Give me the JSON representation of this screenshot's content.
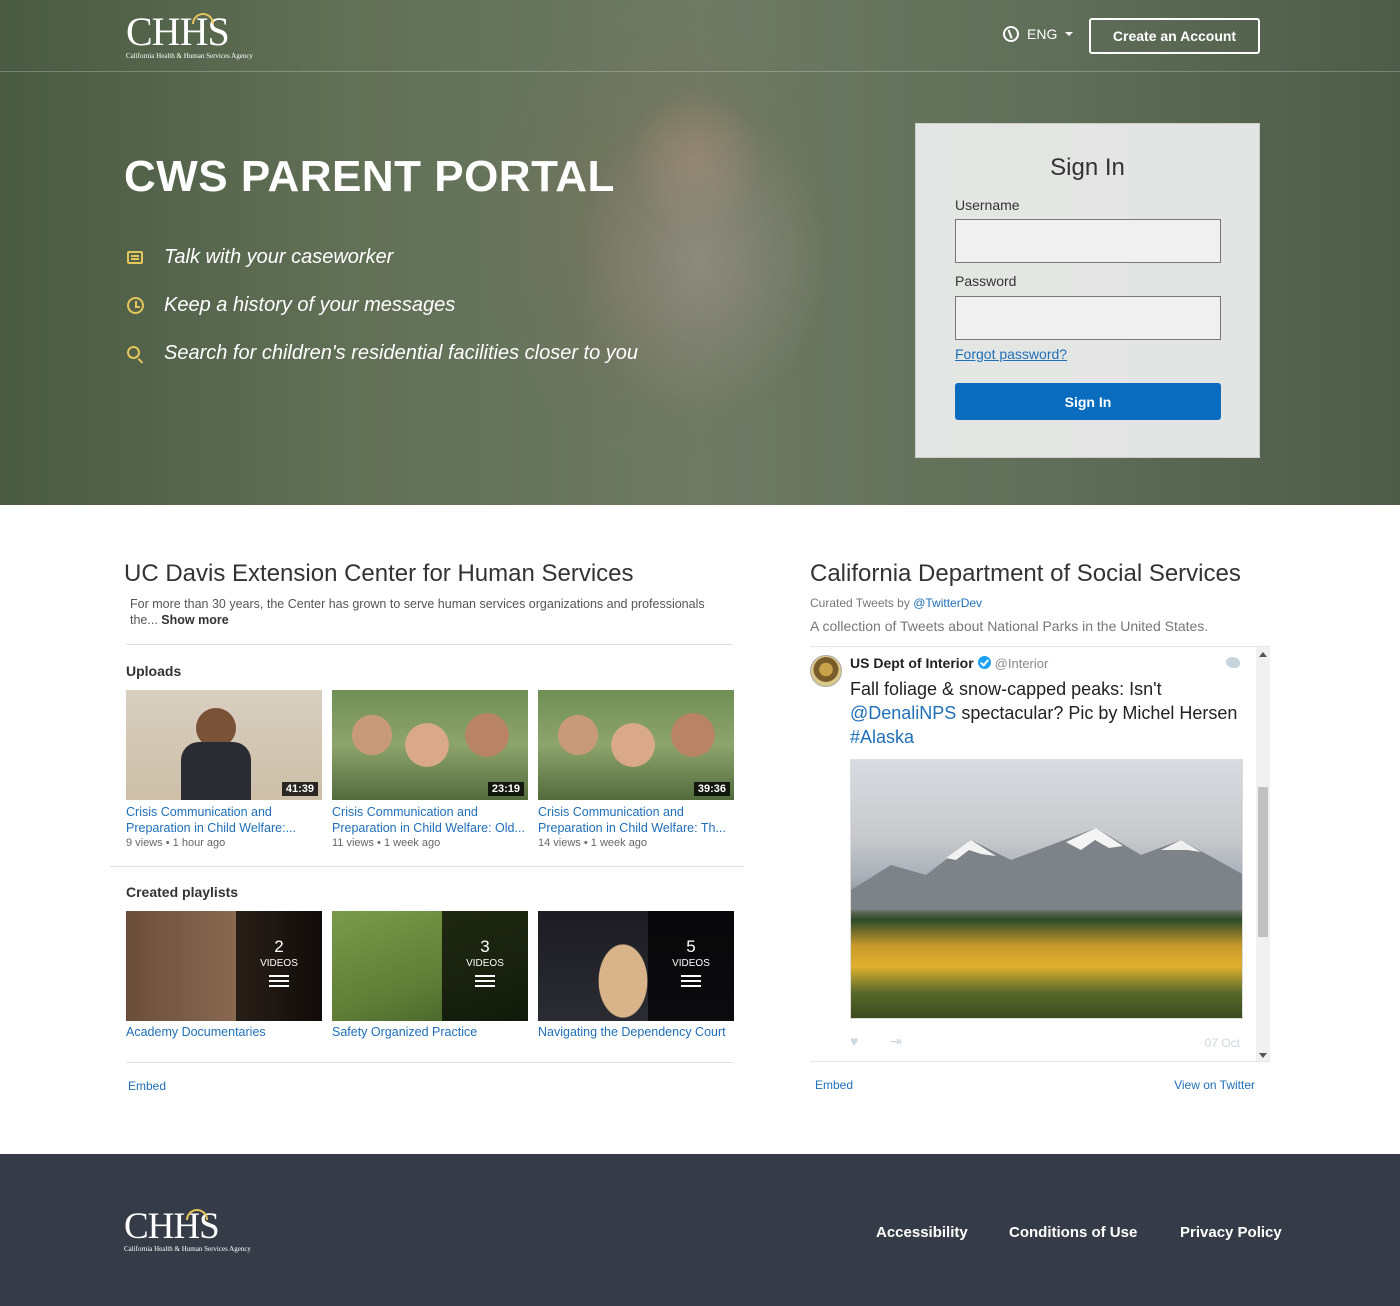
{
  "header": {
    "logo_mark": "CHHS",
    "logo_agency": "California Health & Human Services Agency",
    "language": "ENG",
    "create_account": "Create an Account"
  },
  "hero": {
    "title": "CWS PARENT PORTAL",
    "features": [
      {
        "icon": "chat-icon",
        "text": "Talk with your caseworker"
      },
      {
        "icon": "clock-icon",
        "text": "Keep a history of your messages"
      },
      {
        "icon": "search-icon",
        "text": "Search for children's residential facilities closer to you"
      }
    ]
  },
  "signin": {
    "title": "Sign In",
    "username_label": "Username",
    "username_value": "",
    "password_label": "Password",
    "password_value": "",
    "forgot": "Forgot password?",
    "button": "Sign In"
  },
  "youtube": {
    "title": "UC Davis Extension Center for Human Services",
    "description": "For more than 30 years, the Center has grown to serve human services organizations and professionals the...",
    "show_more": "Show more",
    "uploads_heading": "Uploads",
    "uploads": [
      {
        "title": "Crisis Communication and Preparation in Child Welfare:...",
        "duration": "41:39",
        "views": "9 views",
        "age": "1 hour ago"
      },
      {
        "title": "Crisis Communication and Preparation in Child Welfare: Old...",
        "duration": "23:19",
        "views": "11 views",
        "age": "1 week ago"
      },
      {
        "title": "Crisis Communication and Preparation in Child Welfare: Th...",
        "duration": "39:36",
        "views": "14 views",
        "age": "1 week ago"
      }
    ],
    "playlists_heading": "Created playlists",
    "playlists": [
      {
        "title": "Academy Documentaries",
        "count": "2",
        "label": "VIDEOS"
      },
      {
        "title": "Safety Organized Practice",
        "count": "3",
        "label": "VIDEOS"
      },
      {
        "title": "Navigating the Dependency Court",
        "count": "5",
        "label": "VIDEOS"
      }
    ],
    "embed": "Embed",
    "meta_separator": "•"
  },
  "twitter": {
    "title": "California Department of Social Services",
    "curated_prefix": "Curated Tweets by",
    "curated_handle": "@TwitterDev",
    "collection": "A collection of Tweets about National Parks in the United States.",
    "tweet": {
      "name": "US Dept of Interior",
      "handle": "@Interior",
      "text_1": "Fall foliage & snow-capped peaks: Isn't",
      "mention": "@DenaliNPS",
      "text_2": " spectacular? Pic by Michel Hersen",
      "hashtag": "#Alaska",
      "date": "07 Oct"
    },
    "embed": "Embed",
    "view_on_twitter": "View on Twitter"
  },
  "footer": {
    "logo_mark": "CHHS",
    "logo_agency": "California Health & Human Services Agency",
    "links": [
      "Accessibility",
      "Conditions of Use",
      "Privacy Policy"
    ]
  },
  "colors": {
    "accent_blue": "#0a6cbf",
    "link_blue": "#1f6fb8",
    "icon_gold": "#e5c65a",
    "footer_bg": "#353c48"
  }
}
